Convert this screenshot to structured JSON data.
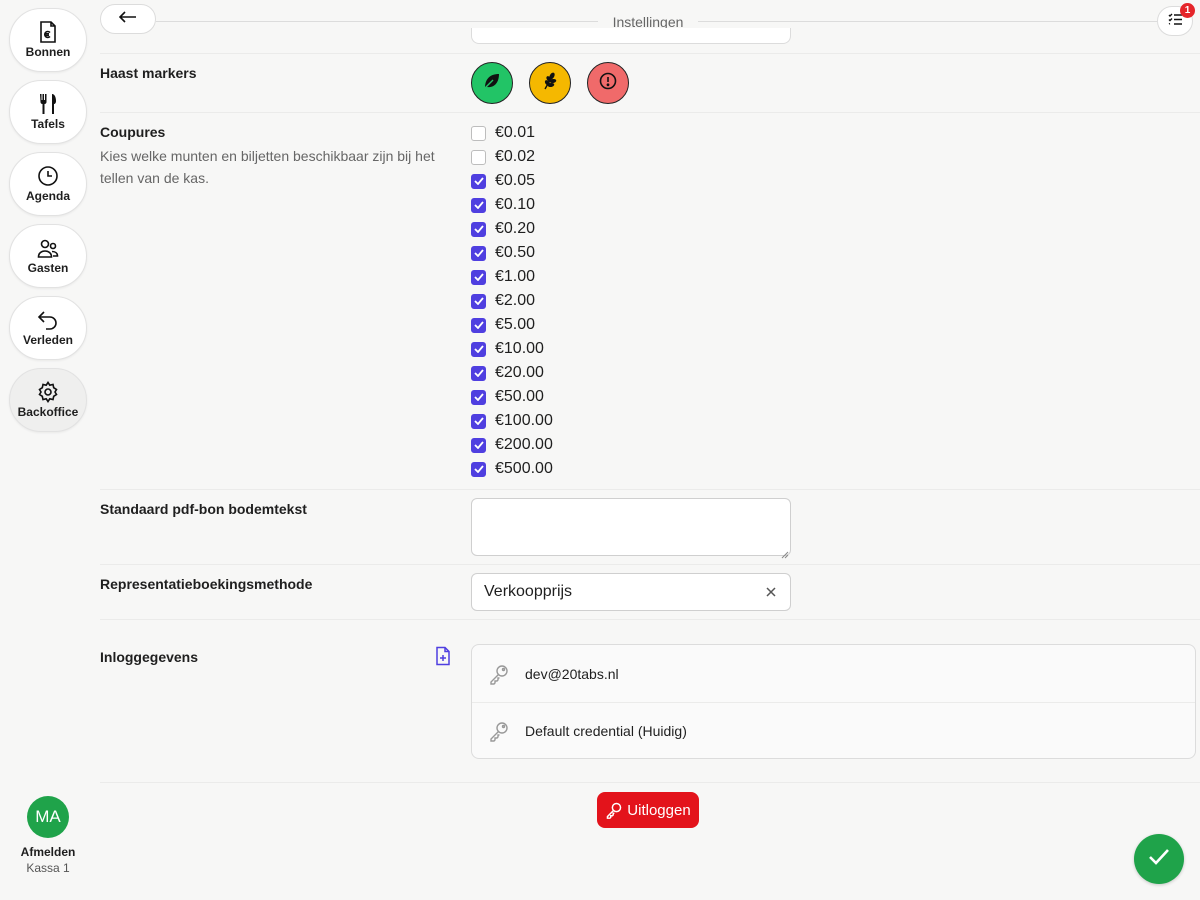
{
  "sidebar": {
    "items": [
      {
        "label": "Bonnen",
        "icon": "receipt-euro-icon"
      },
      {
        "label": "Tafels",
        "icon": "fork-knife-icon"
      },
      {
        "label": "Agenda",
        "icon": "clock-icon"
      },
      {
        "label": "Gasten",
        "icon": "users-icon"
      },
      {
        "label": "Verleden",
        "icon": "undo-arrow-icon"
      },
      {
        "label": "Backoffice",
        "icon": "gear-icon"
      }
    ],
    "user": {
      "initials": "MA",
      "logout_label": "Afmelden",
      "register": "Kassa 1"
    }
  },
  "header": {
    "title": "Instellingen",
    "badge_count": "1"
  },
  "settings": {
    "haast_markers": {
      "label": "Haast markers",
      "markers": [
        {
          "icon": "leaf-icon",
          "color": "#22c466"
        },
        {
          "icon": "wheat-icon",
          "color": "#f5b800"
        },
        {
          "icon": "alert-circle-icon",
          "color": "#f06a6a"
        }
      ]
    },
    "coupures": {
      "label": "Coupures",
      "description": "Kies welke munten en biljetten beschikbaar zijn bij het tellen van de kas.",
      "options": [
        {
          "label": "€0.01",
          "checked": false
        },
        {
          "label": "€0.02",
          "checked": false
        },
        {
          "label": "€0.05",
          "checked": true
        },
        {
          "label": "€0.10",
          "checked": true
        },
        {
          "label": "€0.20",
          "checked": true
        },
        {
          "label": "€0.50",
          "checked": true
        },
        {
          "label": "€1.00",
          "checked": true
        },
        {
          "label": "€2.00",
          "checked": true
        },
        {
          "label": "€5.00",
          "checked": true
        },
        {
          "label": "€10.00",
          "checked": true
        },
        {
          "label": "€20.00",
          "checked": true
        },
        {
          "label": "€50.00",
          "checked": true
        },
        {
          "label": "€100.00",
          "checked": true
        },
        {
          "label": "€200.00",
          "checked": true
        },
        {
          "label": "€500.00",
          "checked": true
        }
      ]
    },
    "pdf_footer": {
      "label": "Standaard pdf-bon bodemtekst",
      "value": ""
    },
    "representation": {
      "label": "Representatieboekingsmethode",
      "value": "Verkoopprijs"
    },
    "credentials": {
      "label": "Inloggegevens",
      "items": [
        "dev@20tabs.nl",
        "Default credential (Huidig)"
      ]
    }
  },
  "actions": {
    "logout_label": "Uitloggen"
  },
  "colors": {
    "accent": "#4f3fe0",
    "danger": "#e3131b",
    "success": "#1fa34a"
  }
}
